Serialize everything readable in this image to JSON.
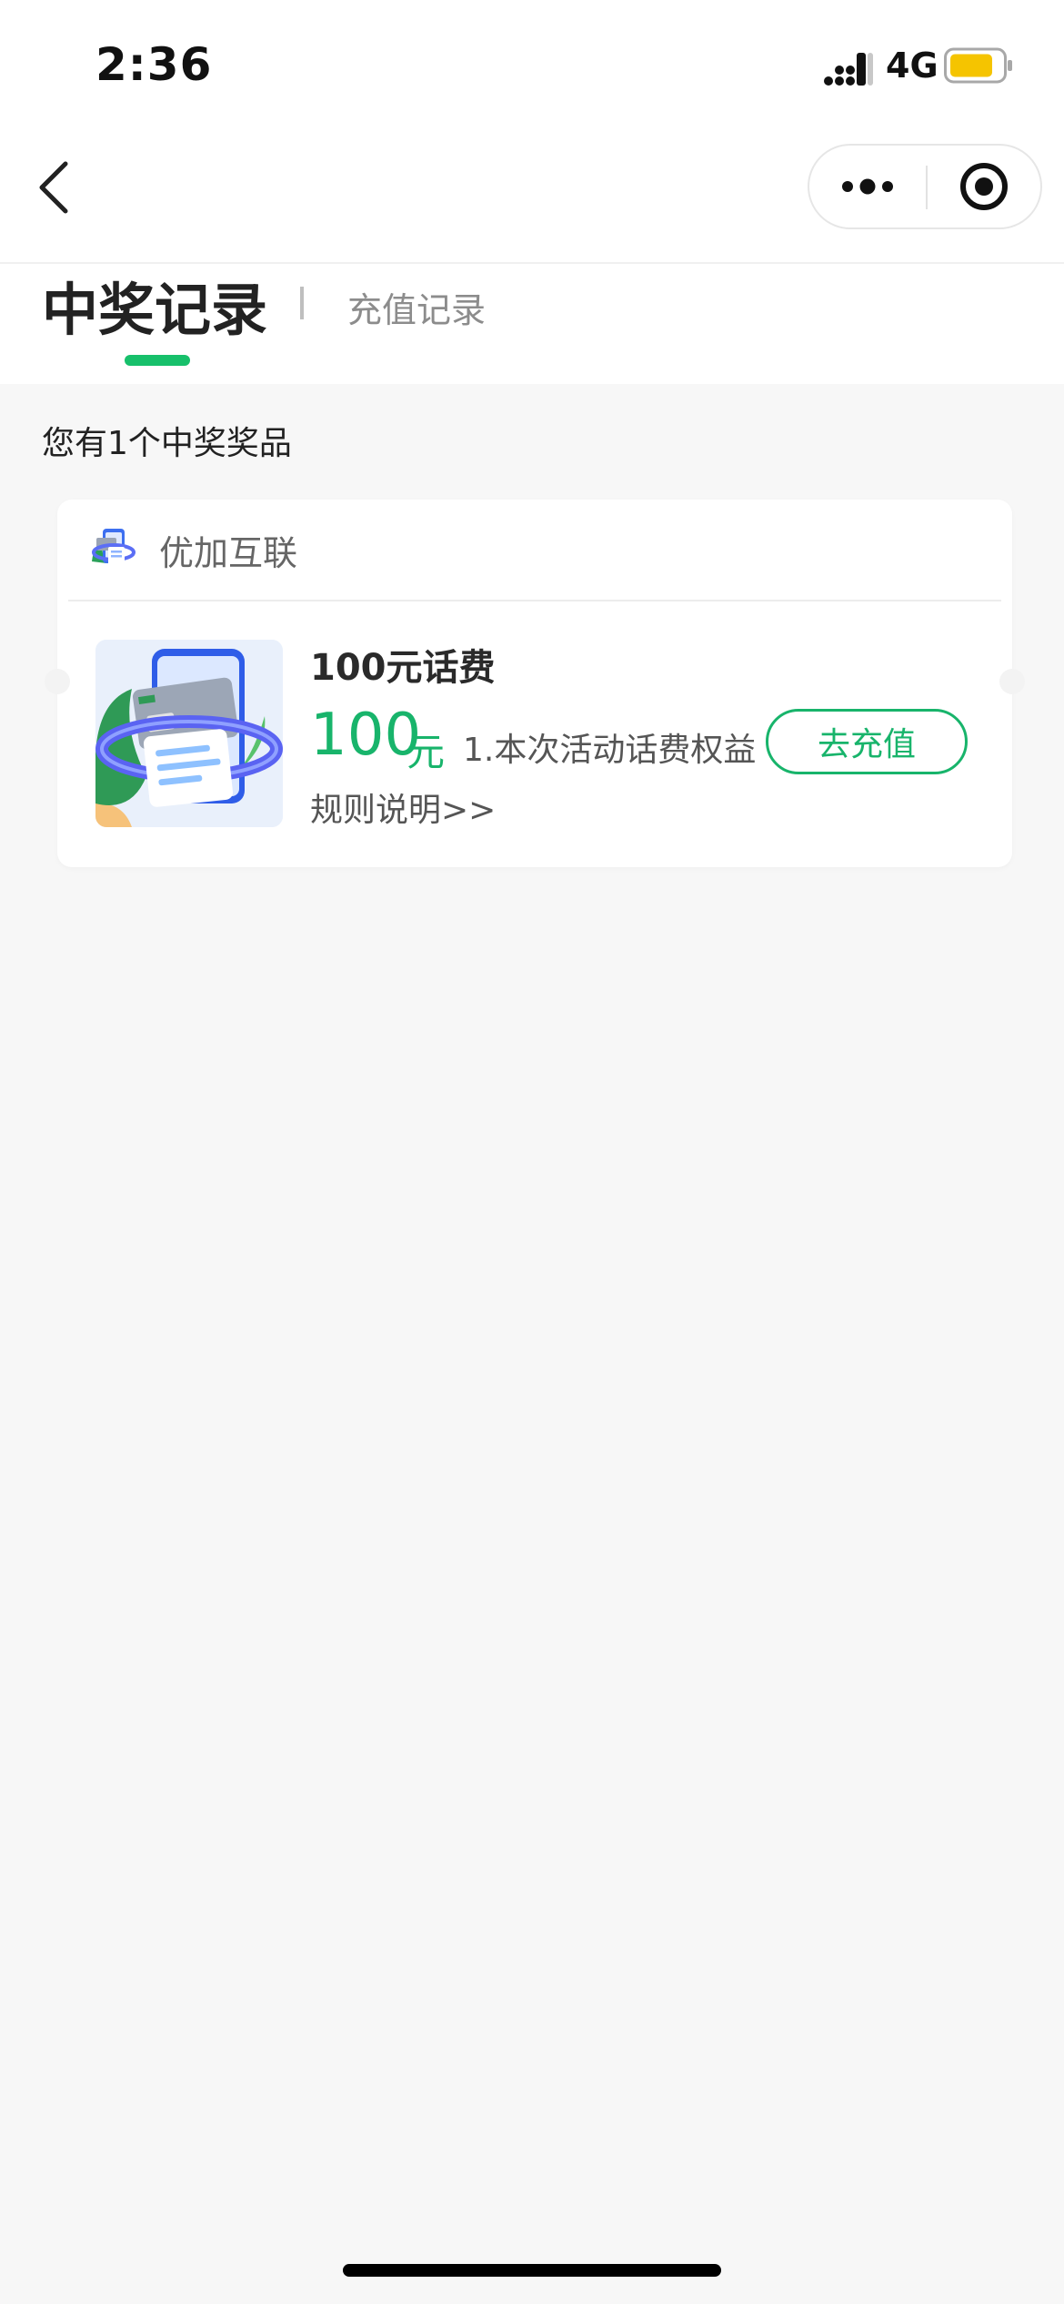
{
  "status_bar": {
    "time": "2:36",
    "network": "4G",
    "signal_icon": "signal-icon",
    "battery_icon": "battery-icon",
    "battery_color": "#f5c400"
  },
  "nav": {
    "back_icon": "chevron-left-icon",
    "more_icon": "more-dots-icon",
    "close_icon": "target-close-icon"
  },
  "tabs": [
    {
      "label": "中奖记录",
      "active": true
    },
    {
      "label": "充值记录",
      "active": false
    }
  ],
  "summary": {
    "text": "您有1个中奖奖品"
  },
  "prize_card": {
    "merchant": "优加互联",
    "title": "100元话费",
    "amount": "100",
    "unit": "元",
    "description": "1.本次活动话费权益",
    "rules_link": "规则说明>>",
    "action_label": "去充值"
  },
  "colors": {
    "accent": "#18b46b",
    "tab_indicator": "#17c06b",
    "background": "#f7f7f7"
  }
}
